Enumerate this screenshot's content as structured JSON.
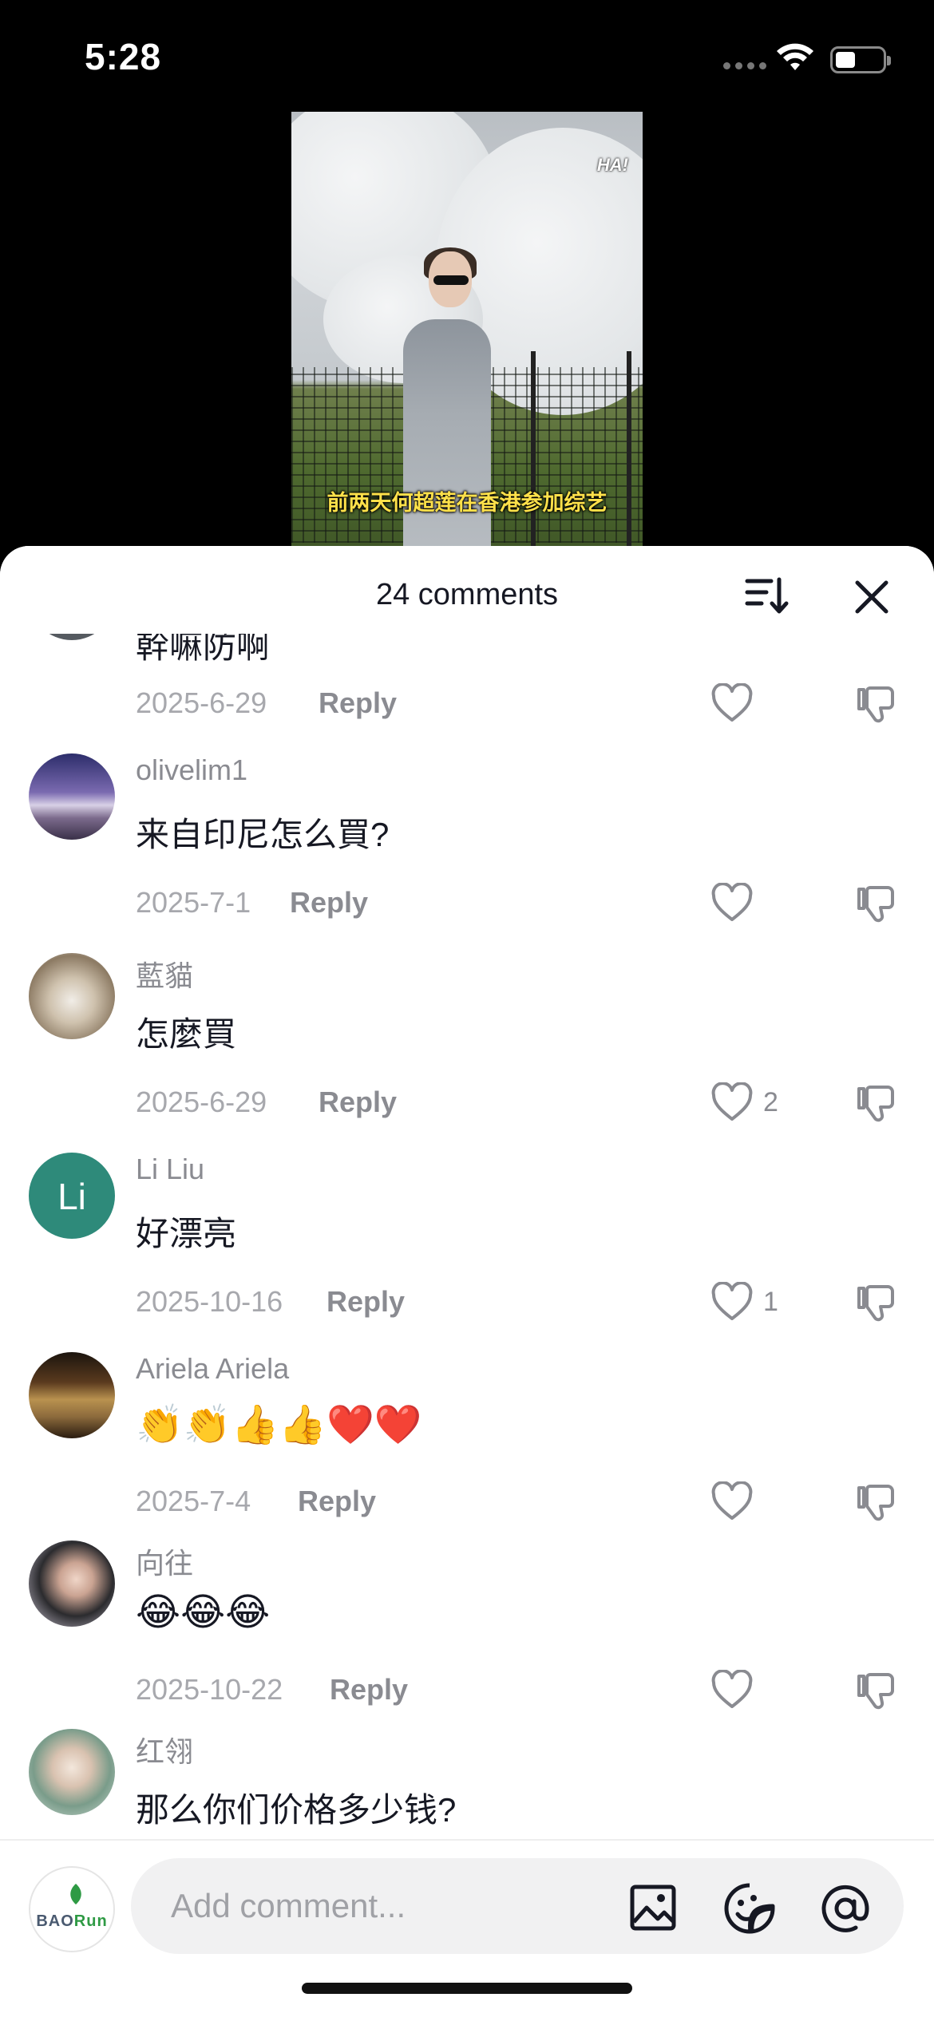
{
  "status_bar": {
    "time": "5:28"
  },
  "video": {
    "badge": "HA!",
    "subtitle": "前两天何超莲在香港参加综艺"
  },
  "sheet": {
    "title": "24 comments",
    "sort_icon": "sort-icon",
    "close_icon": "close-icon"
  },
  "comments": [
    {
      "name": "",
      "text": "幹嘛防啊",
      "date": "2025-6-29",
      "reply": "Reply",
      "likes": "",
      "avatar_color": "#555a60"
    },
    {
      "name": "olivelim1",
      "text": "来自印尼怎么買?",
      "date": "2025-7-1",
      "reply": "Reply",
      "likes": "",
      "avatar_color": "#6f6aa8"
    },
    {
      "name": "藍貓",
      "text": "怎麼買",
      "date": "2025-6-29",
      "reply": "Reply",
      "likes": "2",
      "avatar_color": "#b9a792"
    },
    {
      "name": "Li Liu",
      "text": "好漂亮",
      "date": "2025-10-16",
      "reply": "Reply",
      "likes": "1",
      "avatar_color": "#2e8a7a",
      "initials": "Li"
    },
    {
      "name": "Ariela Ariela",
      "text": "👏👏👍👍❤️❤️",
      "date": "2025-7-4",
      "reply": "Reply",
      "likes": "",
      "avatar_color": "#6b4a2a"
    },
    {
      "name": "向往",
      "text": "😂😂😂",
      "date": "2025-10-22",
      "reply": "Reply",
      "likes": "",
      "avatar_color": "#2b2b2e"
    },
    {
      "name": "红翎",
      "text": "那么你们价格多少钱?",
      "date": "",
      "reply": "",
      "likes": "",
      "avatar_color": "#9fb7a4"
    }
  ],
  "composer": {
    "avatar_brand_prefix": "BAO",
    "avatar_brand_suffix": "Run",
    "placeholder": "Add comment...",
    "icons": [
      "image-icon",
      "sticker-icon",
      "at-icon"
    ]
  }
}
